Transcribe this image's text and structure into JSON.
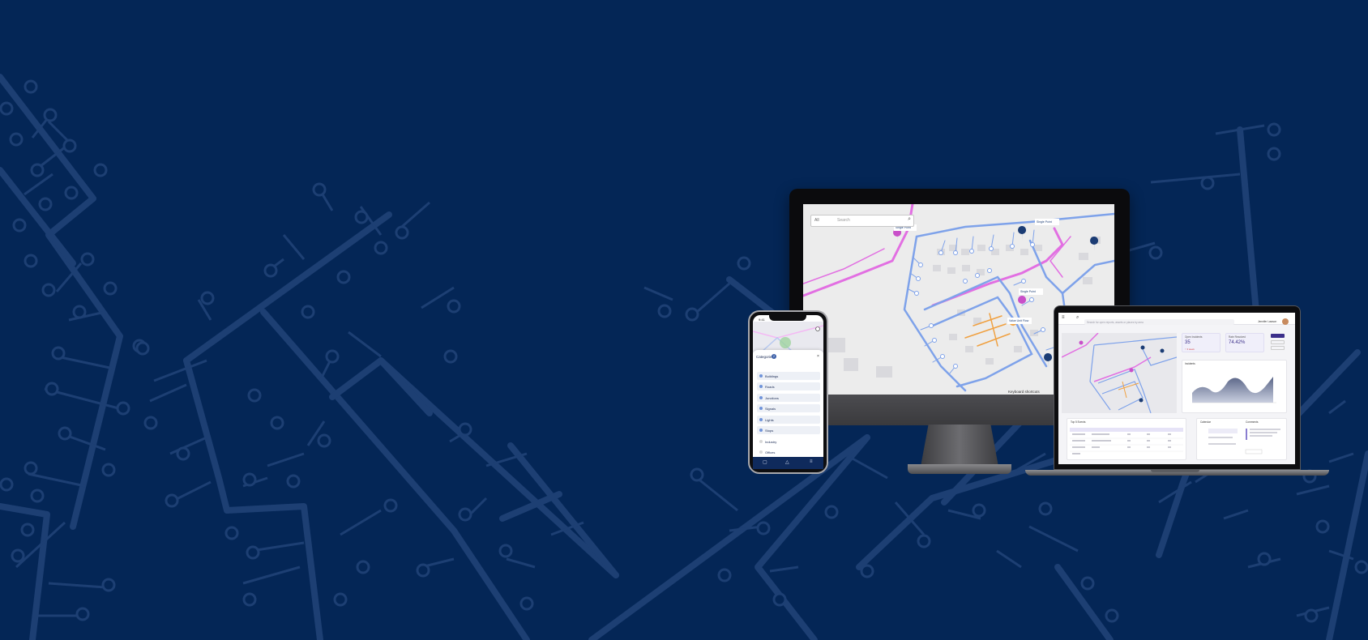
{
  "colors": {
    "background": "#042656",
    "pattern": "#1d3f73",
    "pipe_blue": "#7ea2ea",
    "pipe_pink": "#e26fe2",
    "pipe_orange": "#f0a040",
    "marker_dark": "#1b3c74",
    "marker_pink": "#c94fc9"
  },
  "desktop": {
    "search_select": "All",
    "search_placeholder": "Search",
    "keyboard_shortcuts": "Keyboard shortcuts",
    "map_labels": [
      "Single Point",
      "Single Point",
      "Single Point",
      "Value Unit Flow"
    ]
  },
  "mobile": {
    "time": "9:41",
    "sheet_title": "Categories",
    "sheet_badge": "2",
    "categories": [
      "Buildings",
      "Roads",
      "Junctions",
      "Signals",
      "Lights",
      "Stops",
      "Industry",
      "Offices"
    ]
  },
  "laptop": {
    "search_placeholder": "Search for open reports, assets or places by area",
    "user": "Jennifer Lawson",
    "cards": [
      {
        "title": "Open Incidents",
        "value": "35",
        "sub": "↑ 3 week"
      },
      {
        "title": "Rate Resolved",
        "value": "74.42%",
        "sub": ""
      }
    ],
    "chart_title": "Incidents",
    "table_title": "Top 5 Events",
    "side_titles": [
      "Calendar",
      "Comments"
    ]
  }
}
